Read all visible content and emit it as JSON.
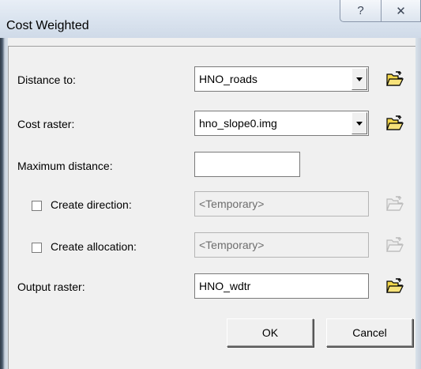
{
  "window": {
    "title": "Cost Weighted",
    "help_glyph": "?",
    "close_glyph": "✕"
  },
  "fields": {
    "distance_to": {
      "label": "Distance to:",
      "value": "HNO_roads"
    },
    "cost_raster": {
      "label": "Cost raster:",
      "value": "hno_slope0.img"
    },
    "maximum_distance": {
      "label": "Maximum distance:",
      "value": ""
    },
    "create_direction": {
      "label": "Create direction:",
      "value": "<Temporary>",
      "checked": false
    },
    "create_allocation": {
      "label": "Create allocation:",
      "value": "<Temporary>",
      "checked": false
    },
    "output_raster": {
      "label": "Output raster:",
      "value": "HNO_wdtr"
    }
  },
  "buttons": {
    "ok": "OK",
    "cancel": "Cancel"
  },
  "icons": {
    "open_folder": "open-folder-icon",
    "dropdown": "chevron-down-icon",
    "help": "help-icon",
    "close": "close-icon"
  }
}
